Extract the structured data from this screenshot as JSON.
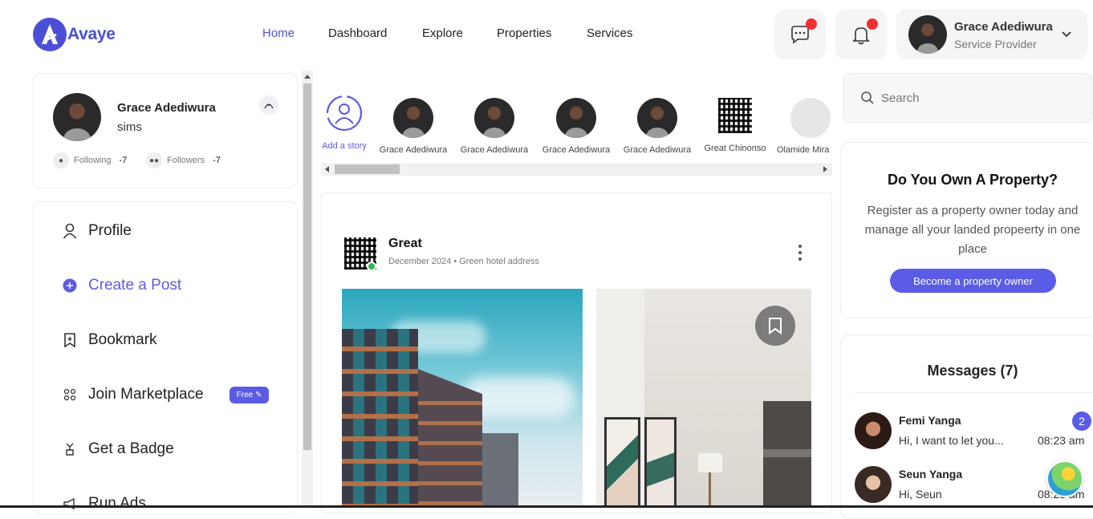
{
  "brand": {
    "name": "Avaye"
  },
  "nav": [
    {
      "label": "Home"
    },
    {
      "label": "Dashboard"
    },
    {
      "label": "Explore"
    },
    {
      "label": "Properties"
    },
    {
      "label": "Services"
    }
  ],
  "account": {
    "name": "Grace Adediwura",
    "role": "Service Provider"
  },
  "user_card": {
    "name": "Grace Adediwura",
    "username": "sims",
    "following_label": "Following",
    "following_count": "-7",
    "followers_label": "Followers",
    "followers_count": "-7"
  },
  "menu": [
    {
      "label": "Profile"
    },
    {
      "label": "Create a Post"
    },
    {
      "label": "Bookmark"
    },
    {
      "label": "Join Marketplace",
      "badge": "Free"
    },
    {
      "label": "Get a Badge"
    },
    {
      "label": "Run Ads"
    }
  ],
  "stories": {
    "add_label": "Add a story",
    "items": [
      {
        "name": "Grace Adediwura"
      },
      {
        "name": "Grace Adediwura"
      },
      {
        "name": "Grace Adediwura"
      },
      {
        "name": "Grace Adediwura"
      },
      {
        "name": "Great Chinonso"
      },
      {
        "name": "Olamide Mira"
      }
    ]
  },
  "post": {
    "author": "Great",
    "meta": "December 2024 • Green hotel address"
  },
  "search": {
    "placeholder": "Search"
  },
  "own_property": {
    "title": "Do You Own A Property?",
    "body": "Register as a property owner today and manage all your landed propeerty in one place",
    "button": "Become a property owner"
  },
  "messages": {
    "title": "Messages (7)",
    "items": [
      {
        "name": "Femi Yanga",
        "preview": "Hi, I want to let you...",
        "time": "08:23 am",
        "unread": "2"
      },
      {
        "name": "Seun Yanga",
        "preview": "Hi, Seun",
        "time": "08:23 am"
      }
    ]
  },
  "colors": {
    "accent": "#5b5ce6",
    "online": "#2dbb4e",
    "alert": "#f03030"
  }
}
